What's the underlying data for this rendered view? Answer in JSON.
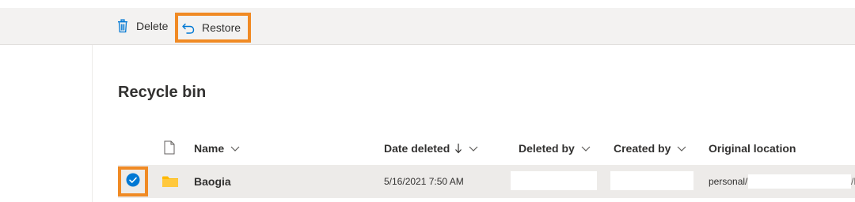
{
  "toolbar": {
    "delete_label": "Delete",
    "restore_label": "Restore"
  },
  "page": {
    "title": "Recycle bin"
  },
  "table": {
    "columns": {
      "name": "Name",
      "date_deleted": "Date deleted",
      "deleted_by": "Deleted by",
      "created_by": "Created by",
      "original_location": "Original location"
    },
    "sort": {
      "column": "date_deleted",
      "direction": "descending"
    },
    "rows": [
      {
        "selected": true,
        "type": "folder-icon",
        "name": "Baogia",
        "date_deleted": "5/16/2021 7:50 AM",
        "deleted_by": "",
        "created_by": "",
        "original_location_prefix": "personal/",
        "original_location_tail": "/D"
      }
    ]
  },
  "colors": {
    "accent": "#0078d4",
    "highlight": "#f08a24",
    "folder": "#ffb900",
    "toolbar_bg": "#f3f2f1",
    "selected_row_bg": "#edebe9"
  }
}
